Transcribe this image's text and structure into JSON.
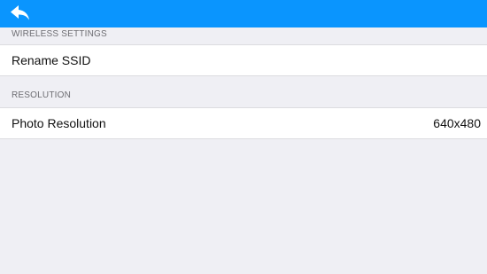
{
  "colors": {
    "nav_bar": "#0a95fe",
    "background": "#efeff4",
    "cell_background": "#ffffff",
    "section_header_text": "#6d6d72"
  },
  "nav": {
    "back_icon": "reply-arrow-icon"
  },
  "sections": {
    "wireless": {
      "header": "WIRELESS SETTINGS",
      "rename_ssid_label": "Rename SSID"
    },
    "resolution": {
      "header": "RESOLUTION",
      "photo_resolution_label": "Photo Resolution",
      "photo_resolution_value": "640x480"
    }
  }
}
